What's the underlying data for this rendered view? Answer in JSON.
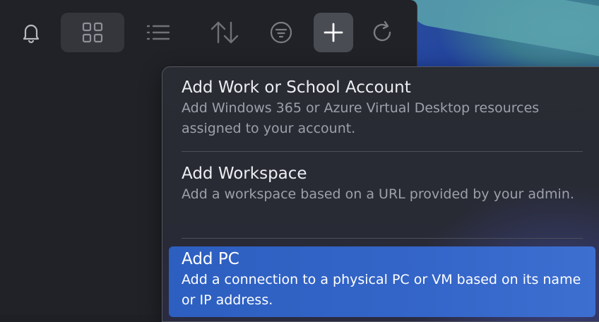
{
  "toolbar": {
    "buttons": [
      {
        "name": "notifications",
        "icon": "bell-icon"
      },
      {
        "name": "tile-view",
        "icon": "grid-icon",
        "active": true
      },
      {
        "name": "list-view",
        "icon": "list-icon"
      },
      {
        "name": "sort",
        "icon": "sort-icon"
      },
      {
        "name": "filter",
        "icon": "filter-icon"
      },
      {
        "name": "add",
        "icon": "plus-icon",
        "pressed": true
      },
      {
        "name": "refresh",
        "icon": "refresh-icon"
      }
    ]
  },
  "add_menu": {
    "items": [
      {
        "title": "Add Work or School Account",
        "description": "Add Windows 365 or Azure Virtual Desktop resources assigned to your account."
      },
      {
        "title": "Add Workspace",
        "description": "Add a workspace based on a URL provided by your admin."
      },
      {
        "title": "Add PC",
        "description": "Add a connection to a physical PC or VM based on its name or IP address.",
        "highlighted": true
      }
    ]
  },
  "colors": {
    "window_bg": "#202227",
    "highlight": "#3465c8",
    "title_text": "#eceef2",
    "desc_text": "#9da0a9"
  }
}
